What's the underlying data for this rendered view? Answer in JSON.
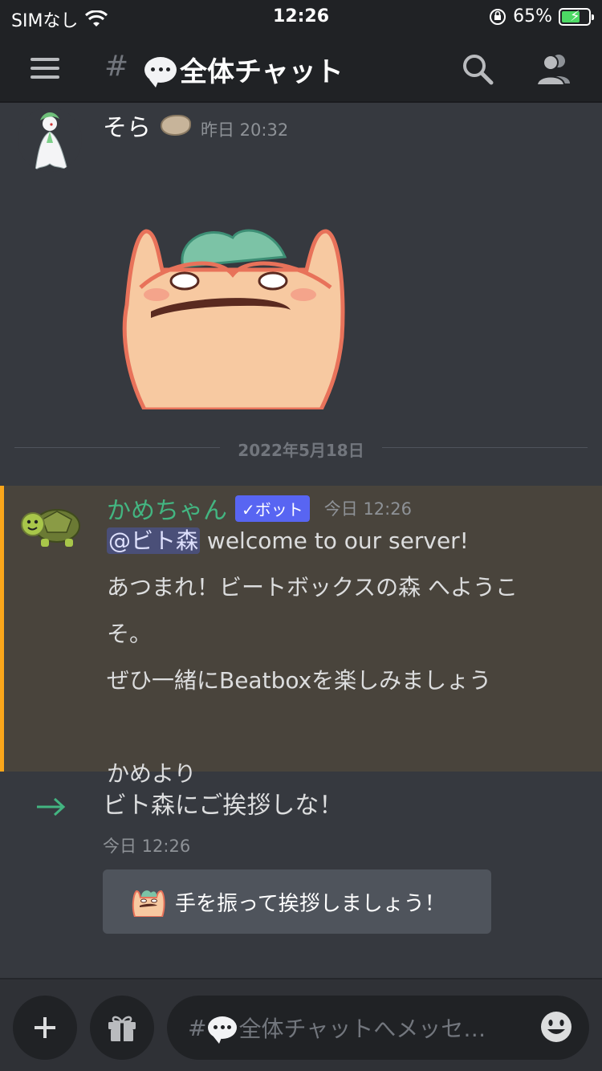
{
  "status_bar": {
    "carrier": "SIMなし",
    "time": "12:26",
    "battery": "65%"
  },
  "header": {
    "channel_hash": "#",
    "channel_name": "全体チャット"
  },
  "messages": [
    {
      "author": "そら",
      "timestamp": "昨日 20:32",
      "content_type": "sticker"
    }
  ],
  "date_divider": "2022年5月18日",
  "welcome_message": {
    "author": "かめちゃん",
    "bot_tag": "✓ボット",
    "timestamp": "今日 12:26",
    "mention": "@ビト森",
    "line1_rest": " welcome to our server!",
    "line2": "あつまれ！ビートボックスの森 へようこ",
    "line3": "そ。",
    "line4": "ぜひ一緒にBeatboxを楽しみましょう",
    "line5": "",
    "line6": "かめより",
    "colors": {
      "author": "#43b581",
      "highlight_border": "#faa61a",
      "bot_tag": "#5865f2"
    }
  },
  "join_message": {
    "text": "ビト森にご挨拶しな！",
    "timestamp": "今日 12:26",
    "wave_button_label": "手を振って挨拶しましょう！"
  },
  "input": {
    "placeholder_hash": "#",
    "placeholder_text": "全体チャットへメッセ…"
  },
  "icons": {
    "menu": "hamburger-icon",
    "search": "search-icon",
    "members": "members-icon",
    "add": "plus-icon",
    "gift": "gift-icon",
    "emoji": "smile-icon",
    "join": "arrow-right-icon"
  }
}
